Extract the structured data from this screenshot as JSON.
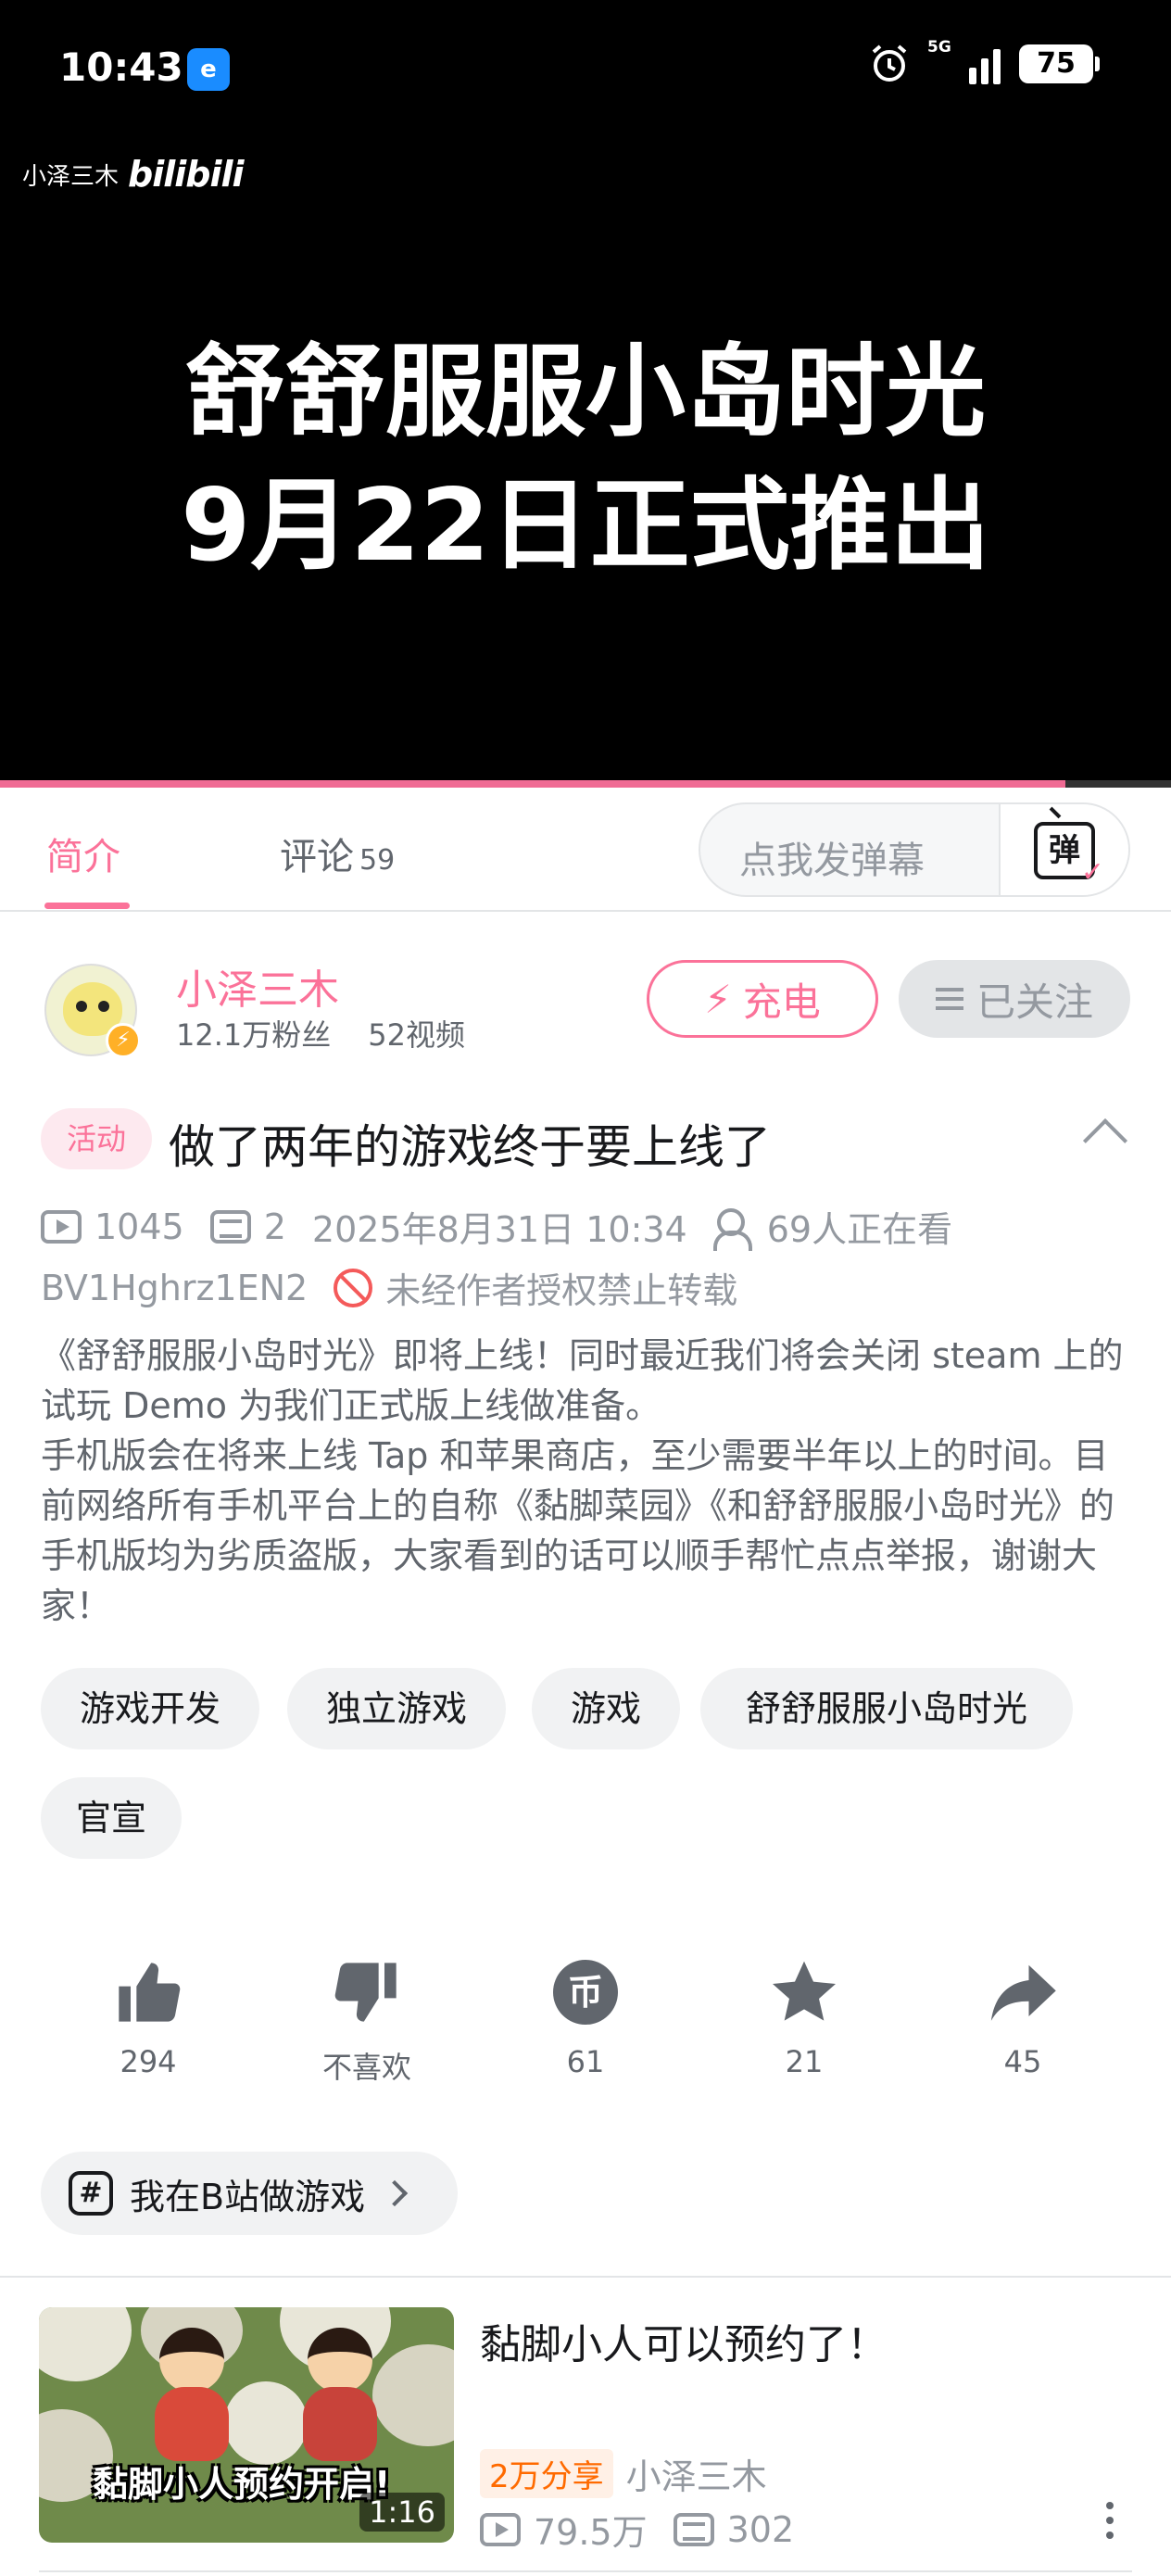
{
  "status_bar": {
    "time": "10:43",
    "app_icon_label": "e",
    "network": "5G",
    "battery": "75"
  },
  "video": {
    "watermark_up": "小泽三木",
    "watermark_logo": "bilibili",
    "title_line1": "舒舒服服小岛时光",
    "title_line2": "9月22日正式推出",
    "progress_fraction": 0.91
  },
  "tabs": {
    "intro": "简介",
    "comments": "评论",
    "comments_count": "59",
    "danmaku_placeholder": "点我发弹幕",
    "danmaku_button": "弹"
  },
  "uploader": {
    "name": "小泽三木",
    "fans": "12.1万粉丝",
    "videos": "52视频",
    "charge_label": "充电",
    "follow_label": "已关注"
  },
  "video_info": {
    "activity_badge": "活动",
    "title": "做了两年的游戏终于要上线了",
    "plays": "1045",
    "danmaku_count": "2",
    "publish_time": "2025年8月31日 10:34",
    "watching": "69人正在看",
    "bvid": "BV1Hghrz1EN2",
    "copyright": "未经作者授权禁止转载",
    "description": [
      "《舒舒服服小岛时光》即将上线！同时最近我们将会关闭 steam 上的试玩 Demo 为我们正式版上线做准备。",
      "手机版会在将来上线 Tap 和苹果商店，至少需要半年以上的时间。目前网络所有手机平台上的自称《黏脚菜园》《和舒舒服服小岛时光》的手机版均为劣质盗版，大家看到的话可以顺手帮忙点点举报，谢谢大家！"
    ],
    "tags": [
      "游戏开发",
      "独立游戏",
      "游戏",
      "舒舒服服小岛时光",
      "官宣"
    ]
  },
  "actions": {
    "like": "294",
    "dislike": "不喜欢",
    "coin": "61",
    "favorite": "21",
    "share": "45"
  },
  "topic": {
    "label": "我在B站做游戏"
  },
  "related": {
    "title": "黏脚小人可以预约了！",
    "thumb_caption": "黏脚小人预约开启!",
    "duration": "1:16",
    "share_badge": "2万分享",
    "author": "小泽三木",
    "plays": "79.5万",
    "danmaku": "302"
  },
  "colors": {
    "accent": "#fb7299",
    "text_primary": "#18191c",
    "text_secondary": "#61666d",
    "text_muted": "#9499a0"
  }
}
